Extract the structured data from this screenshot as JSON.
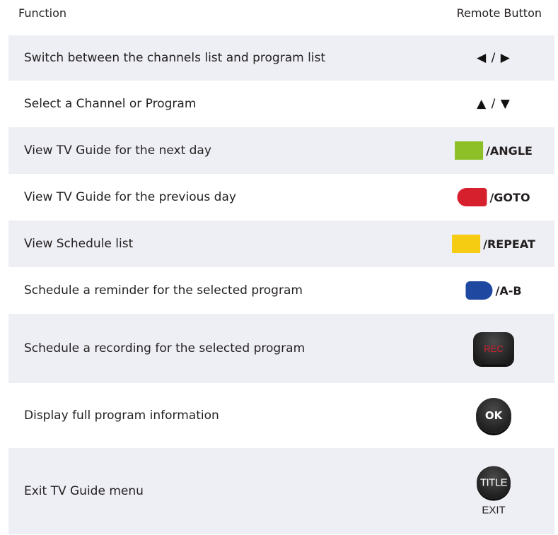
{
  "header": {
    "function_label": "Function",
    "button_label": "Remote Button"
  },
  "rows": [
    {
      "function": "Switch between the channels list and program list",
      "button": {
        "type": "arrows",
        "text": "◀ / ▶"
      }
    },
    {
      "function": "Select a Channel or Program",
      "button": {
        "type": "arrows",
        "text": "▲ / ▼"
      }
    },
    {
      "function": "View TV Guide for the next day",
      "button": {
        "type": "color",
        "color": "#8dc026",
        "label": "/ANGLE"
      }
    },
    {
      "function": "View TV Guide for the previous day",
      "button": {
        "type": "color",
        "color": "#d7202e",
        "label": "/GOTO"
      }
    },
    {
      "function": "View Schedule list",
      "button": {
        "type": "color",
        "color": "#f6cc12",
        "label": "/REPEAT"
      }
    },
    {
      "function": "Schedule a reminder for the selected program",
      "button": {
        "type": "color",
        "color": "#1f48a0",
        "label": "/A-B"
      }
    },
    {
      "function": "Schedule a recording for the selected program",
      "button": {
        "type": "rec",
        "label": "REC"
      }
    },
    {
      "function": "Display full program information",
      "button": {
        "type": "ok",
        "label": "OK"
      }
    },
    {
      "function": "Exit TV Guide menu",
      "button": {
        "type": "title",
        "label": "TITLE",
        "caption": "EXIT"
      }
    }
  ],
  "colors": {
    "row_shade": "#eeeff4",
    "green": "#8dc026",
    "red": "#d7202e",
    "yellow": "#f6cc12",
    "blue": "#1f48a0",
    "button_dark": "#262626",
    "rec_text": "#d0202e"
  },
  "icons": {
    "left_right": "left-right-arrow-icon",
    "up_down": "up-down-arrow-icon",
    "green_key": "green-key-icon",
    "red_key": "red-key-icon",
    "yellow_key": "yellow-key-icon",
    "blue_key": "blue-key-icon",
    "rec": "rec-button-icon",
    "ok": "ok-button-icon",
    "title": "title-button-icon"
  }
}
